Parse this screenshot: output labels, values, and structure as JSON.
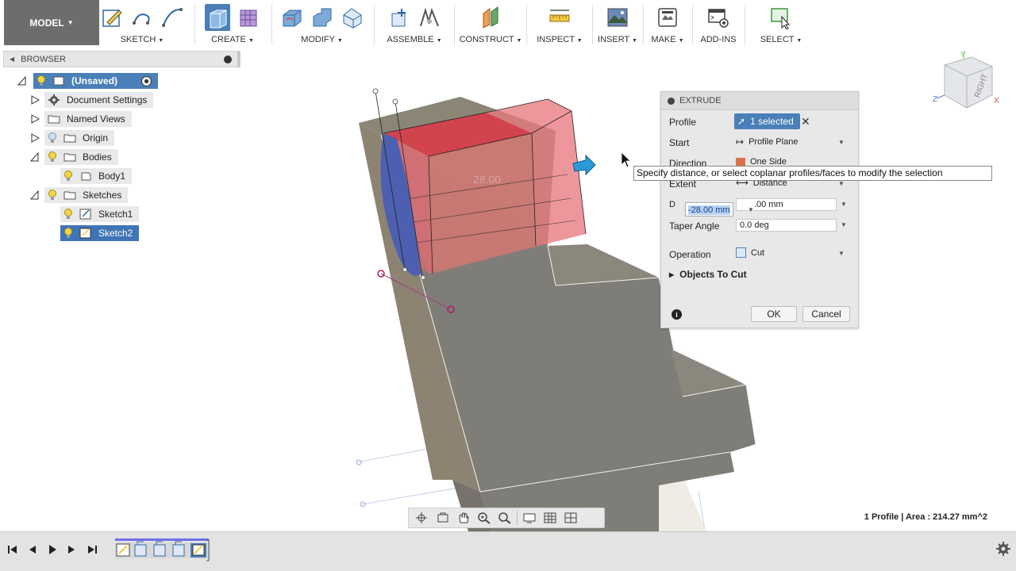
{
  "toolbar": {
    "model_label": "MODEL",
    "groups": [
      {
        "label": "SKETCH"
      },
      {
        "label": "CREATE"
      },
      {
        "label": "MODIFY"
      },
      {
        "label": "ASSEMBLE"
      },
      {
        "label": "CONSTRUCT"
      },
      {
        "label": "INSPECT"
      },
      {
        "label": "INSERT"
      },
      {
        "label": "MAKE"
      },
      {
        "label": "ADD-INS"
      },
      {
        "label": "SELECT"
      }
    ]
  },
  "browser": {
    "title": "BROWSER",
    "items": [
      {
        "label": "(Unsaved)"
      },
      {
        "label": "Document Settings"
      },
      {
        "label": "Named Views"
      },
      {
        "label": "Origin"
      },
      {
        "label": "Bodies"
      },
      {
        "label": "Body1"
      },
      {
        "label": "Sketches"
      },
      {
        "label": "Sketch1"
      },
      {
        "label": "Sketch2"
      }
    ]
  },
  "viewcube": {
    "face": "RIGHT",
    "axis_y": "Y",
    "axis_z": "Z",
    "axis_x": "X"
  },
  "viewport": {
    "dimension_label": "28.00"
  },
  "extrude": {
    "title": "EXTRUDE",
    "profile_label": "Profile",
    "profile_value": "1 selected",
    "start_label": "Start",
    "start_value": "Profile Plane",
    "direction_label": "Direction",
    "direction_value": "One Side",
    "extent_label": "Extent",
    "extent_value": "Distance",
    "distance_label": "D",
    "distance_value": ".00 mm",
    "distance_input": "-28.00 mm",
    "taper_label": "Taper Angle",
    "taper_value": "0.0 deg",
    "operation_label": "Operation",
    "operation_value": "Cut",
    "objects_label": "Objects To Cut",
    "ok_label": "OK",
    "cancel_label": "Cancel"
  },
  "tooltip": "Specify distance, or select coplanar profiles/faces to modify the selection",
  "status": "1 Profile | Area : 214.27 mm^2",
  "colors": {
    "accent": "#3f75b6",
    "body": "#8a8476",
    "cut_preview": "#e87a80",
    "sketch_blue": "#4d5fb0"
  }
}
